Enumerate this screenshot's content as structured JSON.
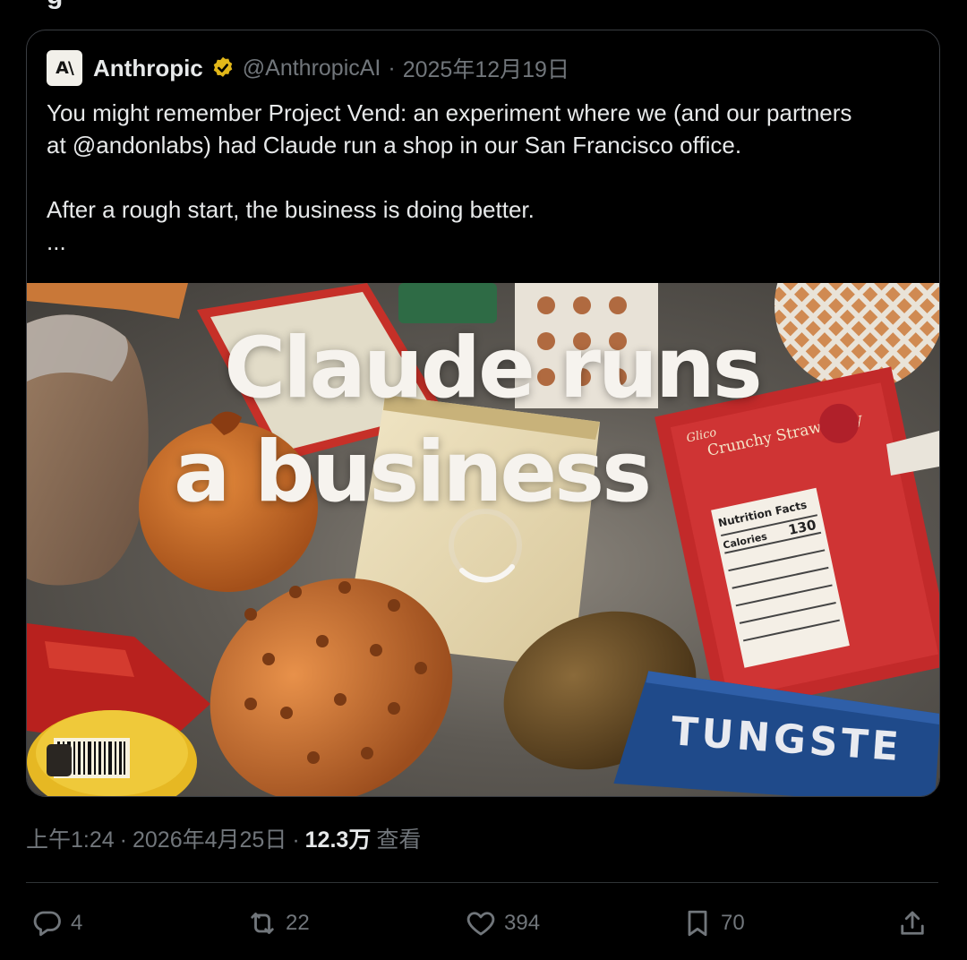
{
  "top_fragment": "g",
  "quote": {
    "author_name": "Anthropic",
    "logo_text": "A\\",
    "handle": "@AnthropicAI",
    "separator": "·",
    "date": "2025年12月19日",
    "text_lines": [
      "You might remember Project Vend: an experiment where we (and our partners",
      "at @andonlabs) had Claude run a shop in our San Francisco office.",
      "After a rough start, the business is doing better.",
      "..."
    ],
    "media": {
      "headline_line1": "Claude runs",
      "headline_line2": "a business",
      "box_brand": "Glico",
      "box_product": "Crunchy Strawberry",
      "nutrition_label": "Nutrition Facts",
      "calories_label": "Calories",
      "calories_value": "130",
      "box_brand_2": "TUNGSTE"
    }
  },
  "meta": {
    "time": "上午1:24",
    "separator": "·",
    "date": "2026年4月25日",
    "views_count": "12.3万",
    "views_label": "查看"
  },
  "actions": {
    "reply_count": "4",
    "repost_count": "22",
    "like_count": "394",
    "bookmark_count": "70"
  },
  "colors": {
    "background": "#000000",
    "text": "#e7e9ea",
    "muted": "#71767b",
    "border": "#2f3336",
    "verified_gold": "#e2b719"
  }
}
